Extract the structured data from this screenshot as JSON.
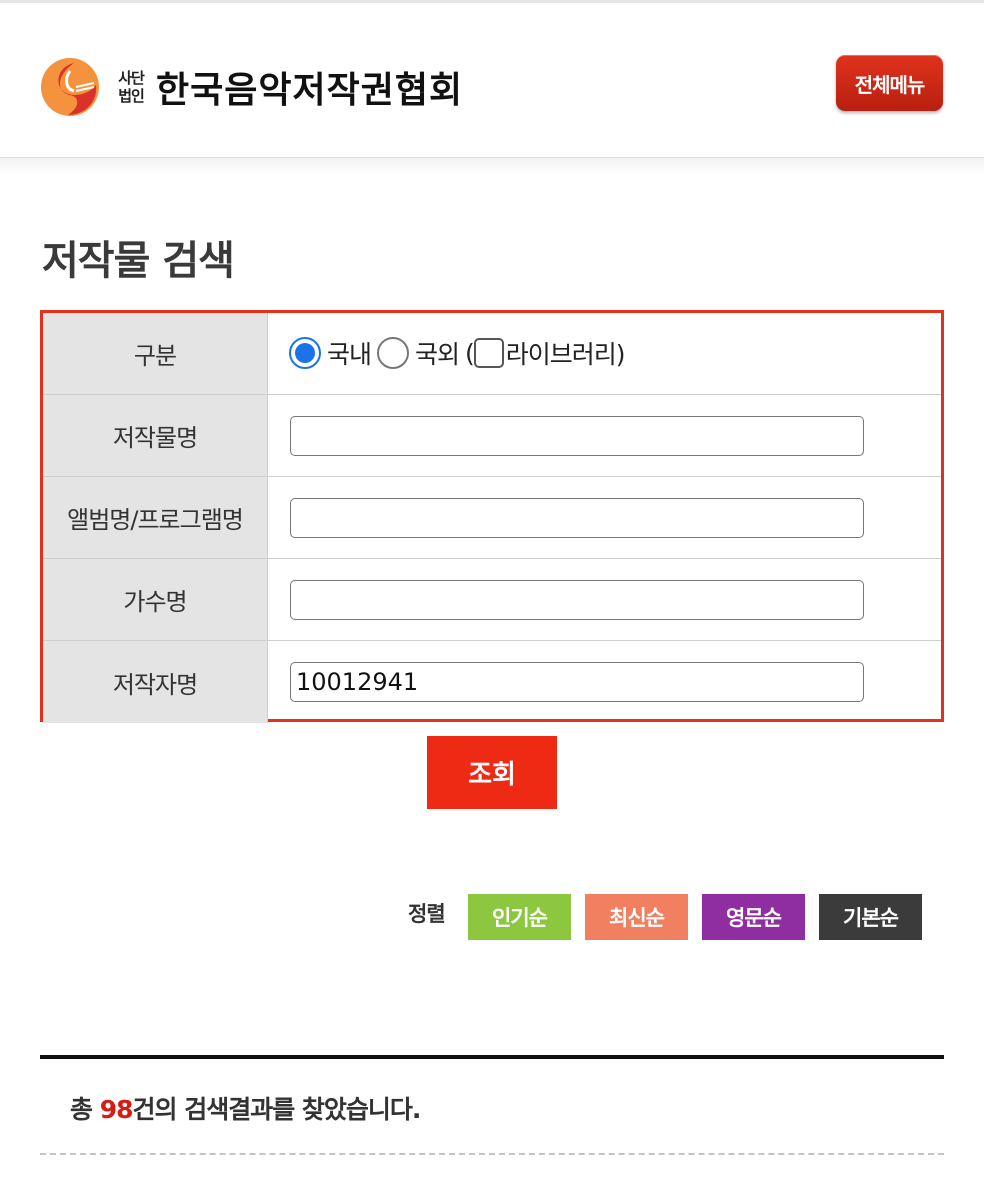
{
  "header": {
    "org_type": "사단법인",
    "org_type_line1": "사단",
    "org_type_line2": "법인",
    "org_name": "한국음악저작권협회",
    "menu_button_label": "전체메뉴",
    "brand_colors": {
      "logo_orange": "#f5923e",
      "logo_red": "#d8322a",
      "menu_red": "#cc2916"
    }
  },
  "page": {
    "title": "저작물 검색"
  },
  "search_form": {
    "border_color": "#e2311d",
    "category": {
      "label": "구분",
      "options": [
        {
          "label": "국내",
          "selected": true
        },
        {
          "label": "국외",
          "selected": false
        }
      ],
      "open_paren": "(",
      "library_checkbox_label": "라이브러리)",
      "library_checked": false
    },
    "fields": [
      {
        "label": "저작물명",
        "value": ""
      },
      {
        "label": "앨범명/프로그램명",
        "value": ""
      },
      {
        "label": "가수명",
        "value": ""
      },
      {
        "label": "저작자명",
        "value": "10012941"
      }
    ],
    "submit_label": "조회"
  },
  "sort": {
    "label": "정렬",
    "options": [
      {
        "label": "인기순",
        "color": "#8dc63f"
      },
      {
        "label": "최신순",
        "color": "#f08060"
      },
      {
        "label": "영문순",
        "color": "#8e2ea0"
      },
      {
        "label": "기본순",
        "color": "#3b3b3b"
      }
    ]
  },
  "results": {
    "prefix": "총 ",
    "count": "98",
    "suffix": "건의 검색결과를 찾았습니다."
  }
}
